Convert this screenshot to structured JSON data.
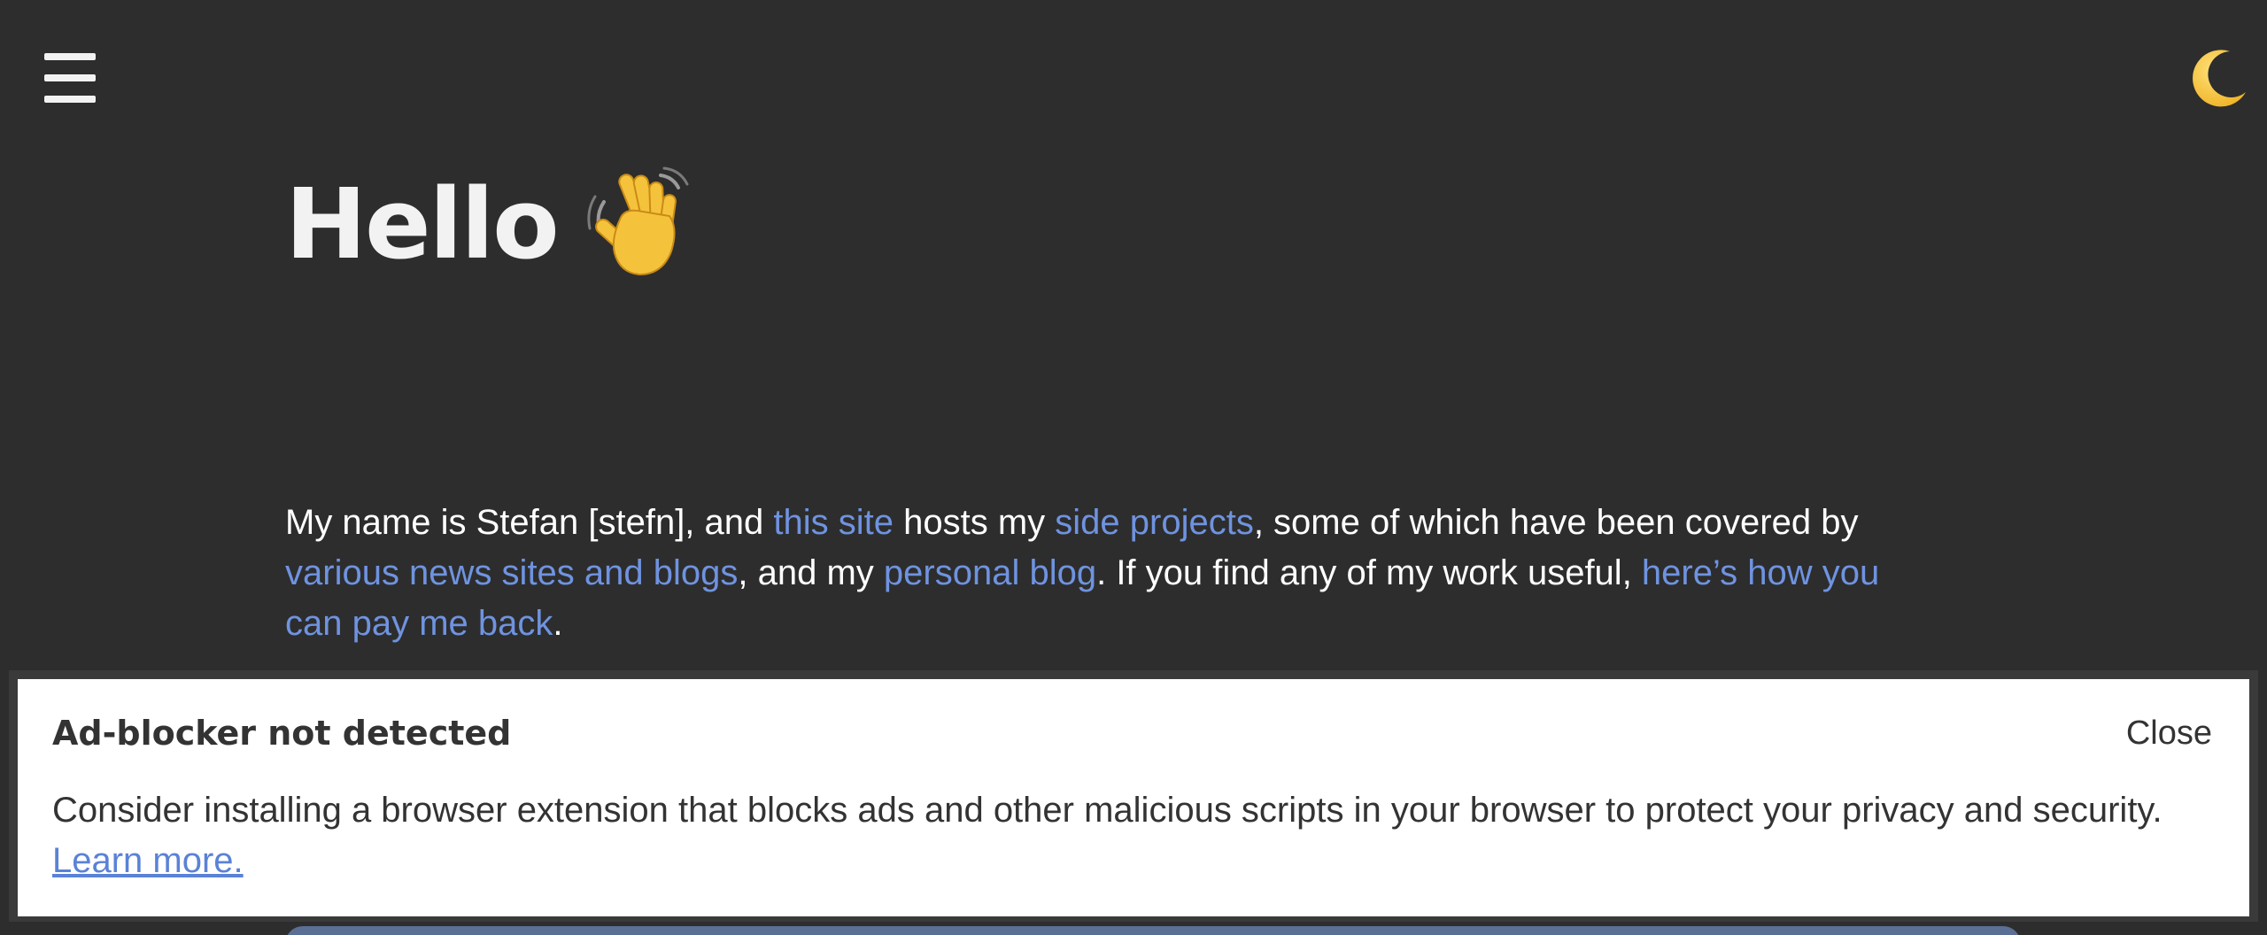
{
  "header": {
    "menu_icon": "hamburger-menu-icon",
    "theme_icon": "crescent-moon-icon"
  },
  "hero": {
    "title": "Hello",
    "emoji_icon": "waving-hand-icon"
  },
  "intro": {
    "t1": "My name is Stefan [stefn], and ",
    "link_this_site": "this site",
    "t2": " hosts my ",
    "link_side_projects": "side projects",
    "t3": ", some of which have been covered by ",
    "link_news": "various news sites and blogs",
    "t4": ", and my ",
    "link_blog": "personal blog",
    "t5": ". If you find any of my work useful, ",
    "link_pay": "here’s how you can pay me back",
    "t6": "."
  },
  "banner": {
    "title": "Ad-blocker not detected",
    "close_label": "Close",
    "body": "Consider installing a browser extension that blocks ads and other malicious scripts in your browser to protect your privacy and security. ",
    "learn_more": "Learn more."
  },
  "colors": {
    "background": "#2d2d2d",
    "link": "#6f93e0",
    "banner_background": "#ffffff",
    "banner_text": "#333333"
  }
}
